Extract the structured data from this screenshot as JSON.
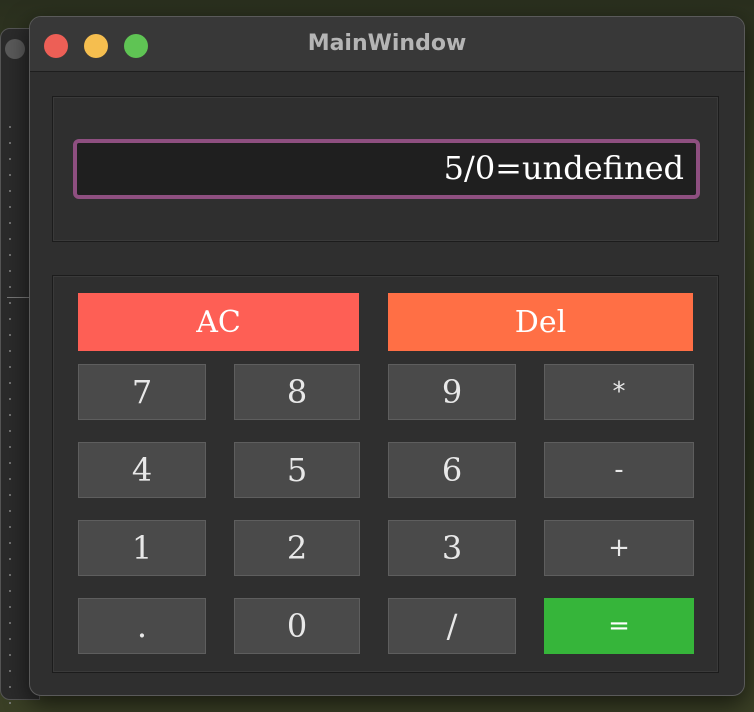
{
  "window": {
    "title": "MainWindow"
  },
  "display": {
    "value": "5/0=undefined"
  },
  "keys": {
    "ac": "AC",
    "del": "Del",
    "k7": "7",
    "k8": "8",
    "k9": "9",
    "mul": "*",
    "k4": "4",
    "k5": "5",
    "k6": "6",
    "sub": "-",
    "k1": "1",
    "k2": "2",
    "k3": "3",
    "add": "+",
    "dot": ".",
    "k0": "0",
    "div": "/",
    "eq": "="
  },
  "colors": {
    "ac": "#fe5f55",
    "del": "#ff6f45",
    "equals": "#36b53a",
    "display_border": "#8e4f80"
  }
}
